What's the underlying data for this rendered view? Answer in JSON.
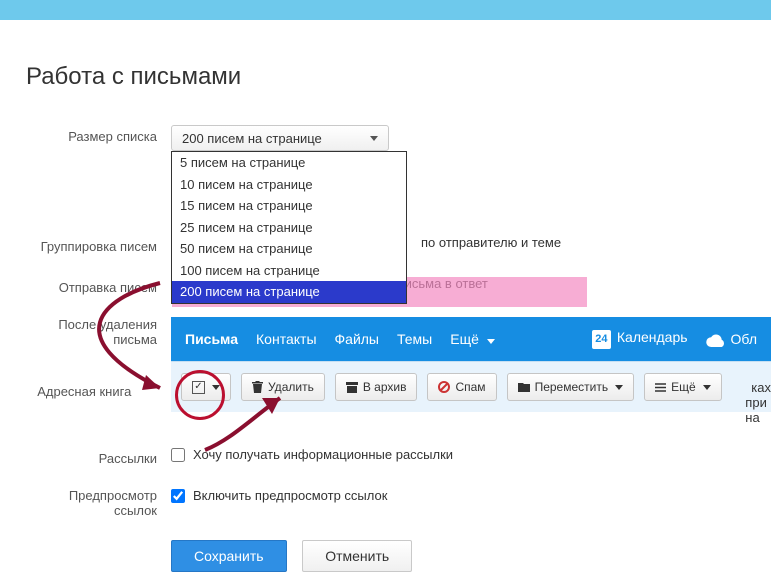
{
  "page_title": "Работа с письмами",
  "rows": {
    "list_size": {
      "label": "Размер списка",
      "selected": "200 писем на странице",
      "options": [
        "5 писем на странице",
        "10 писем на странице",
        "15 писем на странице",
        "25 писем на странице",
        "50 писем на странице",
        "100 писем на странице",
        "200 писем на странице"
      ]
    },
    "grouping": {
      "label": "Группировка писем",
      "suffix": "по отправителю и теме"
    },
    "sending": {
      "label": "Отправка писем",
      "checkbox_label": "Включать содержимое исходного письма в ответ"
    },
    "after_delete": {
      "label_l1": "После удаления",
      "label_l2": "письма"
    },
    "address_book": {
      "label": "Адресная книга",
      "trailing": "ках при на"
    },
    "mailings": {
      "label": "Рассылки",
      "checkbox_label": "Хочу получать информационные рассылки"
    },
    "preview": {
      "label_l1": "Предпросмотр",
      "label_l2": "ссылок",
      "checkbox_label": "Включить предпросмотр ссылок"
    }
  },
  "mail_panel": {
    "tabs": {
      "mail": "Письма",
      "contacts": "Контакты",
      "files": "Файлы",
      "themes": "Темы",
      "more": "Ещё"
    },
    "calendar": "Календарь",
    "calendar_day": "24",
    "cloud": "Обл",
    "toolbar": {
      "delete": "Удалить",
      "archive": "В архив",
      "spam": "Спам",
      "move": "Переместить",
      "more": "Ещё"
    }
  },
  "buttons": {
    "save": "Сохранить",
    "cancel": "Отменить"
  },
  "annotation_color": "#8a0f2f"
}
